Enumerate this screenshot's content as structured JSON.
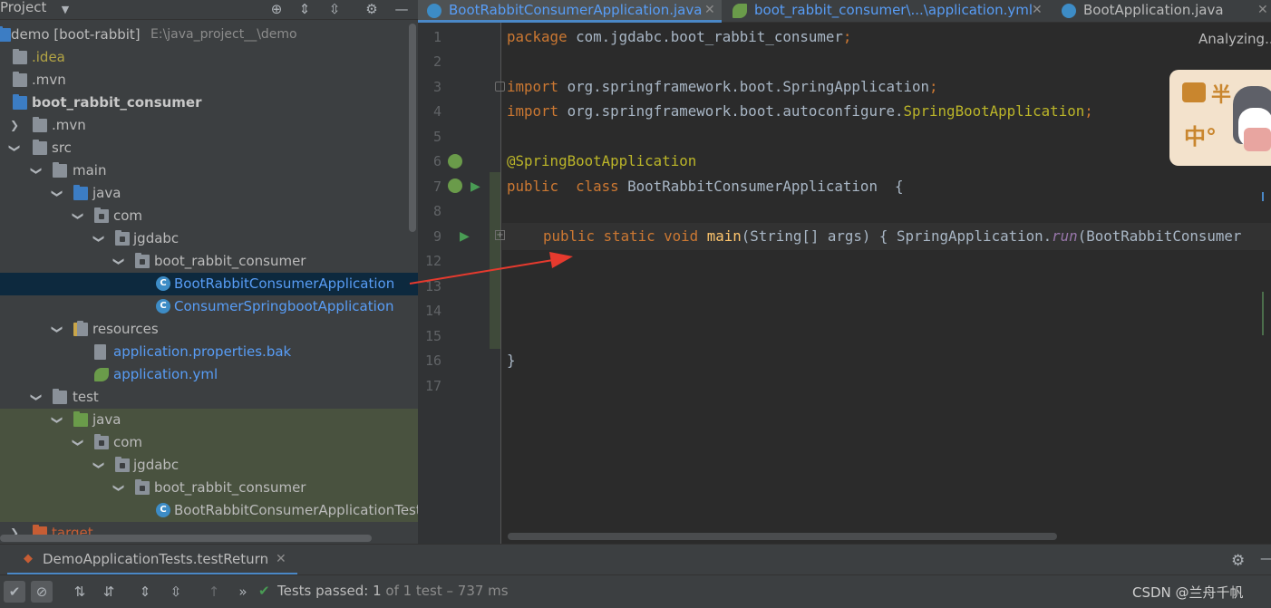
{
  "project_panel": {
    "title": "Project",
    "tree": [
      {
        "label": "demo [boot-rabbit]",
        "path": "E:\\java_project__\\demo"
      },
      {
        "label": ".idea"
      },
      {
        "label": ".mvn"
      },
      {
        "label": "boot_rabbit_consumer"
      },
      {
        "label": ".mvn"
      },
      {
        "label": "src"
      },
      {
        "label": "main"
      },
      {
        "label": "java"
      },
      {
        "label": "com"
      },
      {
        "label": "jgdabc"
      },
      {
        "label": "boot_rabbit_consumer"
      },
      {
        "label": "BootRabbitConsumerApplication"
      },
      {
        "label": "ConsumerSpringbootApplication"
      },
      {
        "label": "resources"
      },
      {
        "label": "application.properties.bak"
      },
      {
        "label": "application.yml"
      },
      {
        "label": "test"
      },
      {
        "label": "java"
      },
      {
        "label": "com"
      },
      {
        "label": "jgdabc"
      },
      {
        "label": "boot_rabbit_consumer"
      },
      {
        "label": "BootRabbitConsumerApplicationTest"
      },
      {
        "label": "target"
      }
    ]
  },
  "editor": {
    "tabs": [
      {
        "label": "BootRabbitConsumerApplication.java"
      },
      {
        "label": "boot_rabbit_consumer\\...\\application.yml"
      },
      {
        "label": "BootApplication.java"
      }
    ],
    "status": "Analyzing...",
    "line_numbers": [
      "1",
      "2",
      "3",
      "4",
      "5",
      "6",
      "7",
      "8",
      "9",
      "12",
      "13",
      "14",
      "15",
      "16",
      "17"
    ],
    "code": {
      "l1_kw": "package",
      "l1_rest": " com.jgdabc.boot_rabbit_consumer",
      "l1_semi": ";",
      "l3_kw": "import",
      "l3_rest": " org.springframework.boot.SpringApplication",
      "l3_semi": ";",
      "l4_kw": "import",
      "l4_rest": " org.springframework.boot.autoconfigure.",
      "l4_cls": "SpringBootApplication",
      "l4_semi": ";",
      "l6_ann": "@SpringBootApplication",
      "l7_kw": "public  class",
      "l7_rest": " BootRabbitConsumerApplication  {",
      "l9_kw": "public static void",
      "l9_fn": " main",
      "l9_args": "(String[] args) { SpringApplication.",
      "l9_run": "run",
      "l9_tail": "(BootRabbitConsumer",
      "l16": "}"
    },
    "sticker_text": [
      "半",
      "中°"
    ]
  },
  "run_panel": {
    "tab_label": "DemoApplicationTests.testReturn",
    "status_prefix": "Tests passed:",
    "status_count": "1",
    "status_suffix": "of 1 test – 737 ms",
    "watermark": "CSDN @兰舟千帆"
  },
  "colors": {
    "accent": "#4a88c7",
    "selection": "#0d293e",
    "test_bg": "#49523f",
    "keyword": "#cc7832",
    "annotation": "#bbb529",
    "function": "#ffc66d",
    "link_blue": "#589df6",
    "passed_green": "#499c54",
    "arrow_red": "#e63a2e"
  }
}
